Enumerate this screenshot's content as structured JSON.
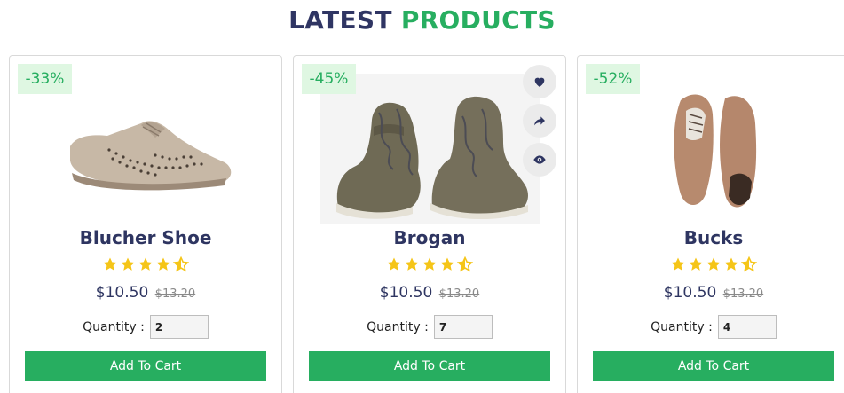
{
  "section": {
    "title_part1": "LATEST",
    "title_part2": "PRODUCTS"
  },
  "colors": {
    "accent": "#27ae60",
    "heading": "#2f3563",
    "star": "#f5c518",
    "discount_bg": "#dff7e2"
  },
  "products": [
    {
      "discount": "-33%",
      "name": "Blucher Shoe",
      "rating": 4.5,
      "price": "$10.50",
      "old_price": "$13.20",
      "quantity_label": "Quantity :",
      "quantity": "2",
      "add_label": "Add To Cart"
    },
    {
      "discount": "-45%",
      "name": "Brogan",
      "rating": 4.5,
      "price": "$10.50",
      "old_price": "$13.20",
      "quantity_label": "Quantity :",
      "quantity": "7",
      "add_label": "Add To Cart",
      "actions": [
        "heart-icon",
        "share-icon",
        "eye-icon"
      ]
    },
    {
      "discount": "-52%",
      "name": "Bucks",
      "rating": 4.5,
      "price": "$10.50",
      "old_price": "$13.20",
      "quantity_label": "Quantity :",
      "quantity": "4",
      "add_label": "Add To Cart"
    }
  ]
}
